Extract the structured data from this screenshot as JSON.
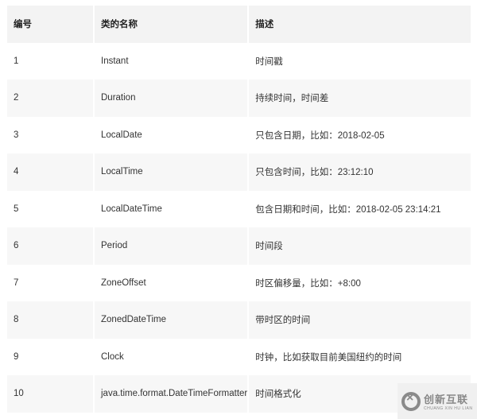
{
  "table": {
    "headers": [
      "编号",
      "类的名称",
      "描述"
    ],
    "rows": [
      [
        "1",
        "Instant",
        "时间戳"
      ],
      [
        "2",
        "Duration",
        "持续时间，时间差"
      ],
      [
        "3",
        "LocalDate",
        "只包含日期，比如：2018-02-05"
      ],
      [
        "4",
        "LocalTime",
        "只包含时间，比如：23:12:10"
      ],
      [
        "5",
        "LocalDateTime",
        "包含日期和时间，比如：2018-02-05 23:14:21"
      ],
      [
        "6",
        "Period",
        "时间段"
      ],
      [
        "7",
        "ZoneOffset",
        "时区偏移量，比如：+8:00"
      ],
      [
        "8",
        "ZonedDateTime",
        "带时区的时间"
      ],
      [
        "9",
        "Clock",
        "时钟，比如获取目前美国纽约的时间"
      ],
      [
        "10",
        "java.time.format.DateTimeFormatter",
        "时间格式化"
      ]
    ]
  },
  "watermark": {
    "title": "创新互联",
    "subtitle": "CHUANG XIN HU LIAN"
  }
}
